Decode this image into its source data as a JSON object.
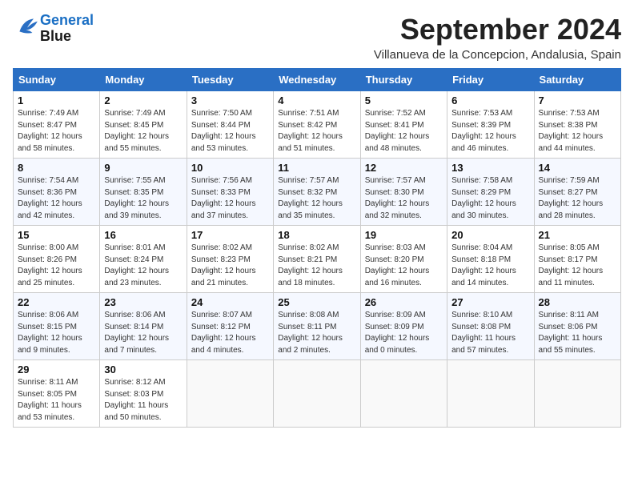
{
  "header": {
    "logo_line1": "General",
    "logo_line2": "Blue",
    "month": "September 2024",
    "location": "Villanueva de la Concepcion, Andalusia, Spain"
  },
  "weekdays": [
    "Sunday",
    "Monday",
    "Tuesday",
    "Wednesday",
    "Thursday",
    "Friday",
    "Saturday"
  ],
  "weeks": [
    [
      {
        "day": "1",
        "info": "Sunrise: 7:49 AM\nSunset: 8:47 PM\nDaylight: 12 hours\nand 58 minutes."
      },
      {
        "day": "2",
        "info": "Sunrise: 7:49 AM\nSunset: 8:45 PM\nDaylight: 12 hours\nand 55 minutes."
      },
      {
        "day": "3",
        "info": "Sunrise: 7:50 AM\nSunset: 8:44 PM\nDaylight: 12 hours\nand 53 minutes."
      },
      {
        "day": "4",
        "info": "Sunrise: 7:51 AM\nSunset: 8:42 PM\nDaylight: 12 hours\nand 51 minutes."
      },
      {
        "day": "5",
        "info": "Sunrise: 7:52 AM\nSunset: 8:41 PM\nDaylight: 12 hours\nand 48 minutes."
      },
      {
        "day": "6",
        "info": "Sunrise: 7:53 AM\nSunset: 8:39 PM\nDaylight: 12 hours\nand 46 minutes."
      },
      {
        "day": "7",
        "info": "Sunrise: 7:53 AM\nSunset: 8:38 PM\nDaylight: 12 hours\nand 44 minutes."
      }
    ],
    [
      {
        "day": "8",
        "info": "Sunrise: 7:54 AM\nSunset: 8:36 PM\nDaylight: 12 hours\nand 42 minutes."
      },
      {
        "day": "9",
        "info": "Sunrise: 7:55 AM\nSunset: 8:35 PM\nDaylight: 12 hours\nand 39 minutes."
      },
      {
        "day": "10",
        "info": "Sunrise: 7:56 AM\nSunset: 8:33 PM\nDaylight: 12 hours\nand 37 minutes."
      },
      {
        "day": "11",
        "info": "Sunrise: 7:57 AM\nSunset: 8:32 PM\nDaylight: 12 hours\nand 35 minutes."
      },
      {
        "day": "12",
        "info": "Sunrise: 7:57 AM\nSunset: 8:30 PM\nDaylight: 12 hours\nand 32 minutes."
      },
      {
        "day": "13",
        "info": "Sunrise: 7:58 AM\nSunset: 8:29 PM\nDaylight: 12 hours\nand 30 minutes."
      },
      {
        "day": "14",
        "info": "Sunrise: 7:59 AM\nSunset: 8:27 PM\nDaylight: 12 hours\nand 28 minutes."
      }
    ],
    [
      {
        "day": "15",
        "info": "Sunrise: 8:00 AM\nSunset: 8:26 PM\nDaylight: 12 hours\nand 25 minutes."
      },
      {
        "day": "16",
        "info": "Sunrise: 8:01 AM\nSunset: 8:24 PM\nDaylight: 12 hours\nand 23 minutes."
      },
      {
        "day": "17",
        "info": "Sunrise: 8:02 AM\nSunset: 8:23 PM\nDaylight: 12 hours\nand 21 minutes."
      },
      {
        "day": "18",
        "info": "Sunrise: 8:02 AM\nSunset: 8:21 PM\nDaylight: 12 hours\nand 18 minutes."
      },
      {
        "day": "19",
        "info": "Sunrise: 8:03 AM\nSunset: 8:20 PM\nDaylight: 12 hours\nand 16 minutes."
      },
      {
        "day": "20",
        "info": "Sunrise: 8:04 AM\nSunset: 8:18 PM\nDaylight: 12 hours\nand 14 minutes."
      },
      {
        "day": "21",
        "info": "Sunrise: 8:05 AM\nSunset: 8:17 PM\nDaylight: 12 hours\nand 11 minutes."
      }
    ],
    [
      {
        "day": "22",
        "info": "Sunrise: 8:06 AM\nSunset: 8:15 PM\nDaylight: 12 hours\nand 9 minutes."
      },
      {
        "day": "23",
        "info": "Sunrise: 8:06 AM\nSunset: 8:14 PM\nDaylight: 12 hours\nand 7 minutes."
      },
      {
        "day": "24",
        "info": "Sunrise: 8:07 AM\nSunset: 8:12 PM\nDaylight: 12 hours\nand 4 minutes."
      },
      {
        "day": "25",
        "info": "Sunrise: 8:08 AM\nSunset: 8:11 PM\nDaylight: 12 hours\nand 2 minutes."
      },
      {
        "day": "26",
        "info": "Sunrise: 8:09 AM\nSunset: 8:09 PM\nDaylight: 12 hours\nand 0 minutes."
      },
      {
        "day": "27",
        "info": "Sunrise: 8:10 AM\nSunset: 8:08 PM\nDaylight: 11 hours\nand 57 minutes."
      },
      {
        "day": "28",
        "info": "Sunrise: 8:11 AM\nSunset: 8:06 PM\nDaylight: 11 hours\nand 55 minutes."
      }
    ],
    [
      {
        "day": "29",
        "info": "Sunrise: 8:11 AM\nSunset: 8:05 PM\nDaylight: 11 hours\nand 53 minutes."
      },
      {
        "day": "30",
        "info": "Sunrise: 8:12 AM\nSunset: 8:03 PM\nDaylight: 11 hours\nand 50 minutes."
      },
      {
        "day": "",
        "info": ""
      },
      {
        "day": "",
        "info": ""
      },
      {
        "day": "",
        "info": ""
      },
      {
        "day": "",
        "info": ""
      },
      {
        "day": "",
        "info": ""
      }
    ]
  ]
}
